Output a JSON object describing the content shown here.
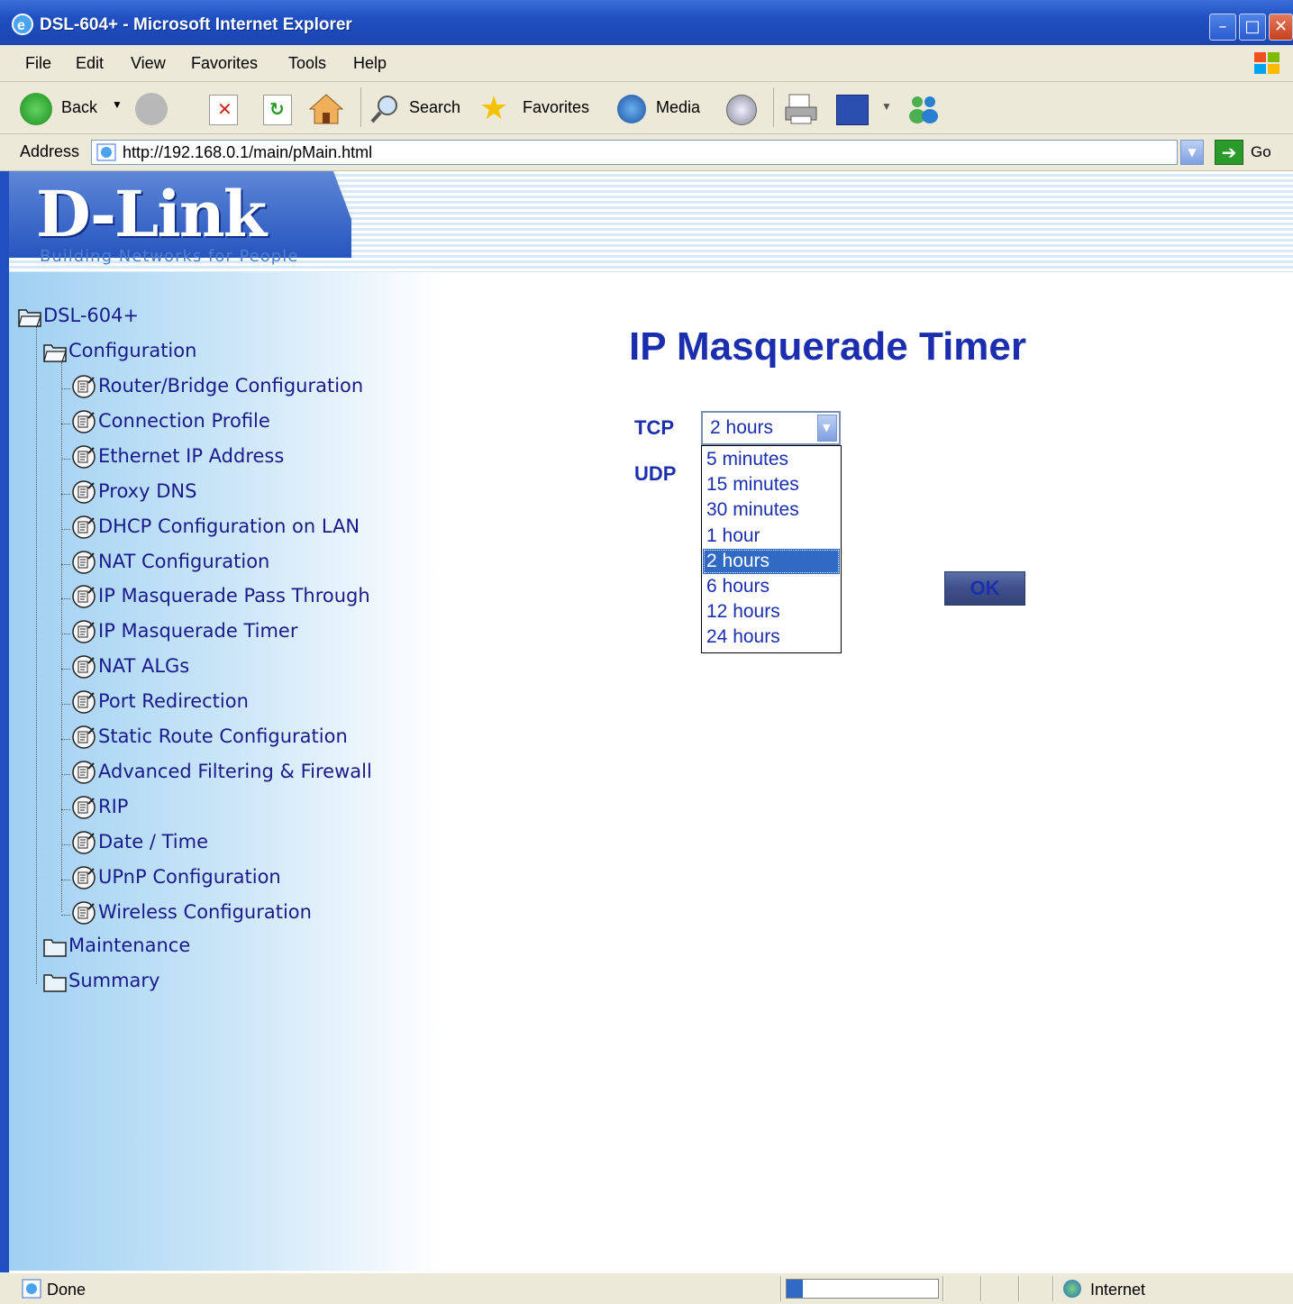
{
  "window": {
    "title": "DSL-604+ - Microsoft Internet Explorer"
  },
  "menu": [
    "File",
    "Edit",
    "View",
    "Favorites",
    "Tools",
    "Help"
  ],
  "toolbar": {
    "back": "Back",
    "search": "Search",
    "favorites": "Favorites",
    "media": "Media"
  },
  "address": {
    "label": "Address",
    "url": "http://192.168.0.1/main/pMain.html",
    "go": "Go"
  },
  "banner": {
    "logo": "D-Link",
    "tagline": "Building Networks for People"
  },
  "tree": {
    "root": "DSL-604+",
    "configuration": "Configuration",
    "items": [
      "Router/Bridge Configuration",
      "Connection Profile",
      "Ethernet IP Address",
      "Proxy DNS",
      "DHCP Configuration on LAN",
      "NAT Configuration",
      "IP Masquerade Pass Through",
      "IP Masquerade Timer",
      "NAT ALGs",
      "Port Redirection",
      "Static Route Configuration",
      "Advanced Filtering & Firewall",
      "RIP",
      "Date / Time",
      "UPnP Configuration",
      "Wireless Configuration"
    ],
    "maintenance": "Maintenance",
    "summary": "Summary"
  },
  "main": {
    "title": "IP Masquerade Timer",
    "tcp_label": "TCP",
    "udp_label": "UDP",
    "tcp_value": "2 hours",
    "options": [
      "5 minutes",
      "15 minutes",
      "30 minutes",
      "1 hour",
      "2 hours",
      "6 hours",
      "12 hours",
      "24 hours"
    ],
    "selected_option": "2 hours",
    "ok": "OK"
  },
  "status": {
    "left": "Done",
    "zone": "Internet"
  },
  "colors": {
    "link": "#1a1a8a",
    "title": "#1b2fae",
    "xp_blue": "#1f4fc1",
    "highlight": "#316ac5"
  }
}
